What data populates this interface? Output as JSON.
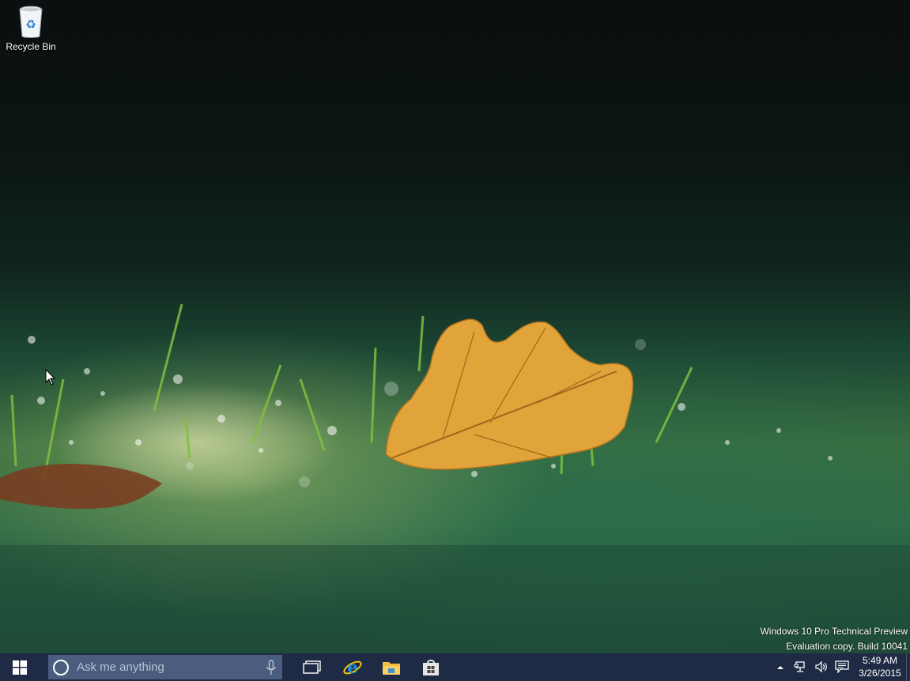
{
  "desktop": {
    "icons": [
      {
        "label": "Recycle Bin",
        "icon": "recycle-bin-icon"
      }
    ],
    "watermark": {
      "line1": "Windows 10 Pro Technical Preview",
      "line2": "Evaluation copy. Build 10041"
    }
  },
  "taskbar": {
    "start_icon": "windows-logo-icon",
    "search": {
      "placeholder": "Ask me anything",
      "cortana_icon": "cortana-ring-icon",
      "mic_icon": "microphone-icon"
    },
    "pinned_apps": [
      {
        "name": "Task View",
        "icon": "task-view-icon"
      },
      {
        "name": "Internet Explorer",
        "icon": "internet-explorer-icon"
      },
      {
        "name": "File Explorer",
        "icon": "folder-icon"
      },
      {
        "name": "Store",
        "icon": "store-bag-icon"
      }
    ],
    "tray": {
      "icons": [
        "chevron-up-icon",
        "network-icon",
        "volume-icon",
        "action-center-icon"
      ],
      "time": "5:49 AM",
      "date": "3/26/2015"
    },
    "colors": {
      "taskbar_bg": "#1f2a44",
      "search_bg": "#4a5d7e",
      "ie_blue": "#1e8ee0",
      "folder_yellow": "#f0c040"
    }
  }
}
